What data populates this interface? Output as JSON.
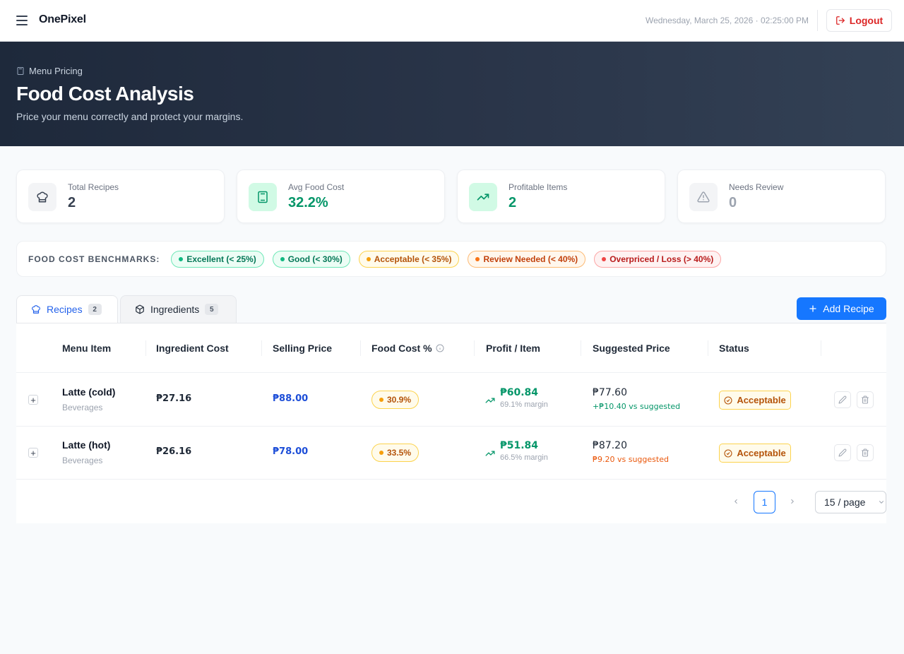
{
  "topbar": {
    "brand": "OnePixel",
    "datetime": "Wednesday, March 25, 2026 · 02:25:00 PM",
    "logout_label": "Logout"
  },
  "hero": {
    "breadcrumb": "Menu Pricing",
    "title": "Food Cost Analysis",
    "subtitle": "Price your menu correctly and protect your margins."
  },
  "stats": [
    {
      "label": "Total Recipes",
      "value": "2",
      "icon": "chef-hat-icon",
      "color": "#374151"
    },
    {
      "label": "Avg Food Cost",
      "value": "32.2%",
      "icon": "calculator-icon",
      "color": "#059669"
    },
    {
      "label": "Profitable Items",
      "value": "2",
      "icon": "trending-up-icon",
      "color": "#059669"
    },
    {
      "label": "Needs Review",
      "value": "0",
      "icon": "warning-icon",
      "color": "#9ca3af"
    }
  ],
  "benchmarks": {
    "label": "FOOD COST BENCHMARKS:",
    "items": [
      {
        "label": "Excellent (< 25%)",
        "color": "#10b981"
      },
      {
        "label": "Good (< 30%)",
        "color": "#10b981"
      },
      {
        "label": "Acceptable (< 35%)",
        "color": "#f59e0b"
      },
      {
        "label": "Review Needed (< 40%)",
        "color": "#f97316"
      },
      {
        "label": "Overpriced / Loss (> 40%)",
        "color": "#ef4444"
      }
    ]
  },
  "tabs": [
    {
      "label": "Recipes",
      "count": "2"
    },
    {
      "label": "Ingredients",
      "count": "5"
    }
  ],
  "add_recipe_label": "Add Recipe",
  "table": {
    "headers": [
      "Menu Item",
      "Ingredient Cost",
      "Selling Price",
      "Food Cost %",
      "Profit / Item",
      "Suggested Price",
      "Status"
    ],
    "rows": [
      {
        "name": "Latte (cold)",
        "category": "Beverages",
        "ingredient_cost": "₱27.16",
        "selling_price": "₱88.00",
        "food_cost_pct": "30.9%",
        "profit": "₱60.84",
        "margin": "69.1% margin",
        "suggested": "₱77.60",
        "suggested_diff": "+₱10.40 vs suggested",
        "status": "Acceptable"
      },
      {
        "name": "Latte (hot)",
        "category": "Beverages",
        "ingredient_cost": "₱26.16",
        "selling_price": "₱78.00",
        "food_cost_pct": "33.5%",
        "profit": "₱51.84",
        "margin": "66.5% margin",
        "suggested": "₱87.20",
        "suggested_diff": "₱9.20 vs suggested",
        "status": "Acceptable"
      }
    ]
  },
  "pagination": {
    "current_page": "1",
    "page_size": "15 / page"
  },
  "colors": {
    "accent": "#1677ff",
    "danger": "#dc2626",
    "success": "#059669",
    "warning": "#b45309"
  }
}
